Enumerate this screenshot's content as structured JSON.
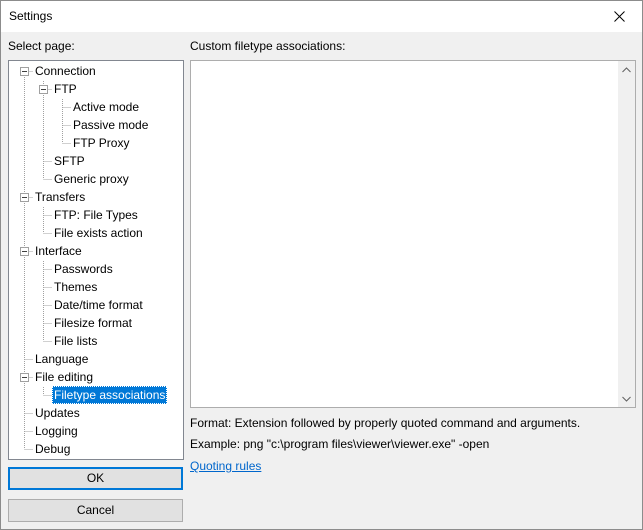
{
  "window": {
    "title": "Settings"
  },
  "labels": {
    "select_page": "Select page:",
    "custom_assoc": "Custom filetype associations:"
  },
  "tree": {
    "connection": "Connection",
    "ftp": "FTP",
    "active_mode": "Active mode",
    "passive_mode": "Passive mode",
    "ftp_proxy": "FTP Proxy",
    "sftp": "SFTP",
    "generic_proxy": "Generic proxy",
    "transfers": "Transfers",
    "ftp_file_types": "FTP: File Types",
    "file_exists_action": "File exists action",
    "interface": "Interface",
    "passwords": "Passwords",
    "themes": "Themes",
    "date_time_format": "Date/time format",
    "filesize_format": "Filesize format",
    "file_lists": "File lists",
    "language": "Language",
    "file_editing": "File editing",
    "filetype_associations": "Filetype associations",
    "updates": "Updates",
    "logging": "Logging",
    "debug": "Debug"
  },
  "info": {
    "format": "Format: Extension followed by properly quoted command and arguments.",
    "example": "Example: png \"c:\\program files\\viewer\\viewer.exe\" -open",
    "quoting_rules": "Quoting rules"
  },
  "buttons": {
    "ok": "OK",
    "cancel": "Cancel"
  },
  "icons": {
    "close": "close-icon",
    "scroll_up": "chevron-up-icon",
    "scroll_down": "chevron-down-icon",
    "expander": "minus-box-icon"
  },
  "colors": {
    "selection": "#0078d7",
    "link": "#0066cc",
    "default_button_border": "#0078d7"
  }
}
